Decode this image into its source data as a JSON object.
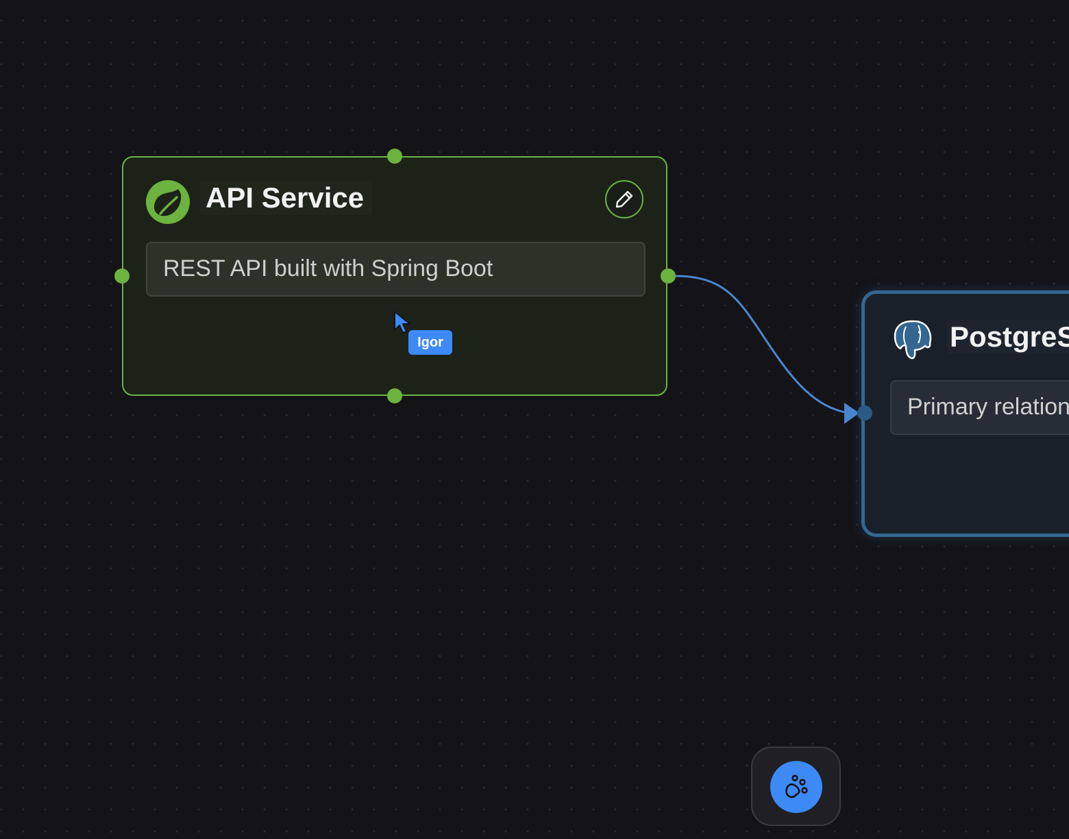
{
  "canvas": {
    "background": "#141318",
    "dot_color": "#2c2b31"
  },
  "nodes": {
    "api_service": {
      "title": "API Service",
      "description": "REST API built with Spring Boot",
      "icon": "spring-leaf-icon",
      "accent": "#6cb33f",
      "edit_icon": "pencil-icon"
    },
    "postgres": {
      "title": "PostgreSQL",
      "description": "Primary relational database",
      "icon": "postgres-elephant-icon",
      "accent": "#336791"
    }
  },
  "edges": [
    {
      "from": "api_service",
      "to": "postgres",
      "color": "#4a86cf"
    }
  ],
  "collaborator_cursor": {
    "name": "Igor",
    "color": "#3d8af7"
  },
  "toolbar": {
    "action_icon": "paw-icon",
    "accent": "#3d8af7"
  }
}
